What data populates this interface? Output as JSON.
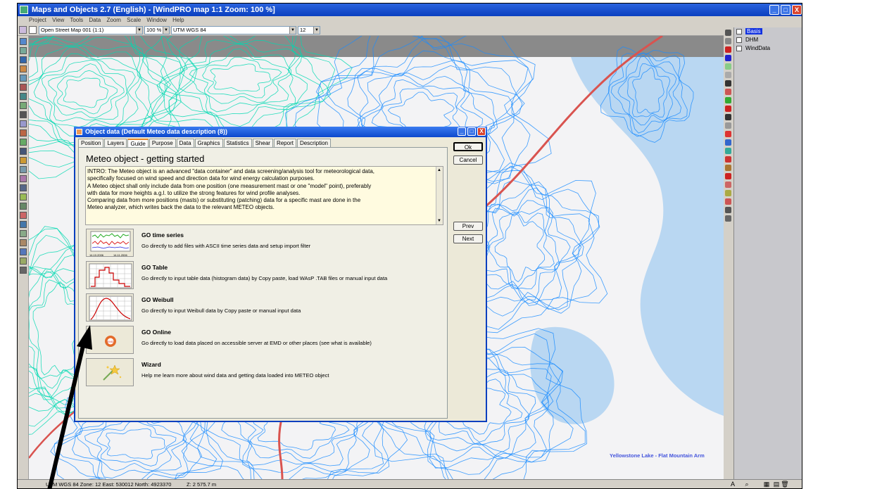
{
  "window": {
    "title": "Maps and Objects 2.7 (English) - [WindPRO map 1:1 Zoom: 100 %]",
    "buttons": [
      "_",
      "□",
      "X"
    ]
  },
  "menu": [
    "Project",
    "View",
    "Tools",
    "Data",
    "Zoom",
    "Scale",
    "Window",
    "Help"
  ],
  "toolbar": {
    "map_combo": "Open Street Map 001 (1:1)",
    "zoom_combo": "100 %",
    "coord_combo": "UTM WGS 84",
    "zone_combo": "12"
  },
  "layers": [
    {
      "label": "Basis",
      "selected": true
    },
    {
      "label": "DHM",
      "selected": false
    },
    {
      "label": "WindData",
      "selected": false
    }
  ],
  "map": {
    "place_label": "Yellowstone Lake - Flat Mountain Arm"
  },
  "dialog": {
    "title": "Object data  (Default Meteo data description (8))",
    "tabs": [
      "Position",
      "Layers",
      "Guide",
      "Purpose",
      "Data",
      "Graphics",
      "Statistics",
      "Shear",
      "Report",
      "Description"
    ],
    "active_tab": "Guide",
    "heading": "Meteo object - getting started",
    "intro_lines": [
      "INTRO: The Meteo object is an advanced \"data container\" and data screening/analysis tool for meteorological data,",
      "specifically focused on wind speed and direction data for wind energy calculation purposes.",
      "A Meteo object shall only include data from one position (one measurement mast or one \"model\" point), preferably",
      "with data for more heights a.g.l. to utilize the strong features for wind profile analyses.",
      "Comparing data from more positions (masts) or substituting (patching) data for a specific mast are done in the",
      "Meteo analyzer, which writes back the data to the relevant METEO objects."
    ],
    "options": [
      {
        "title": "GO time series",
        "desc": "Go directly to add files with ASCII time series data and setup import filter",
        "thumb_dates": [
          "14.10.2006",
          "14.11.2006"
        ]
      },
      {
        "title": "GO Table",
        "desc": "Go directly to input table data (histogram data) by Copy paste, load WAsP .TAB files or manual input data"
      },
      {
        "title": "GO Weibull",
        "desc": "Go directly to input Weibull data by Copy paste or manual input data"
      },
      {
        "title": "GO Online",
        "desc": "Go directly to load data placed on accessible server at EMD or other places (see what is available)",
        "logo": "EMD"
      },
      {
        "title": "Wizard",
        "desc": "Help me learn more about wind data and getting data loaded into METEO object"
      }
    ],
    "buttons": {
      "ok": "Ok",
      "cancel": "Cancel",
      "prev": "Prev",
      "next": "Next"
    }
  },
  "status": {
    "coords": "UTM WGS 84 Zone: 12  East: 530012  North: 4923370",
    "z": "Z: 2 575.7 m"
  },
  "colors": {
    "contour_dense": "#00d8b0",
    "contour": "#1a8cff",
    "water": "#b9d7f2",
    "road": "#d9534f",
    "arrow": "#000000"
  }
}
